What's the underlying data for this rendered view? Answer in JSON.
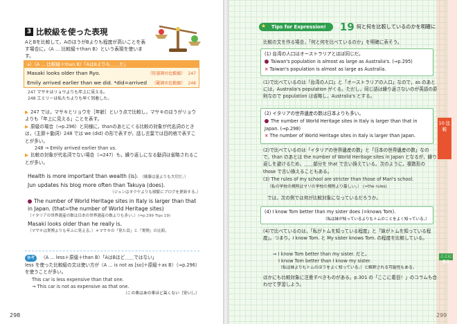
{
  "left": {
    "page_number": "298",
    "section_number": "3",
    "section_title": "比較級を使った表現",
    "intro": "AとBを比較して，AのほうがBよりも程度が高いことを表す場合に，〈A ... 比較級＋than B〉という表現を使います。",
    "example_box_header": "a）〈A ... 比較級＋than B〉「AはBよりも＿＿だ」",
    "examples": [
      {
        "text": "Masaki looks older than Ryo.",
        "sub": "（形容詞の比較級）",
        "num": "247"
      },
      {
        "text": "Emily arrived earlier than we did.  *did=arrived",
        "sub": "（副詞の比較級）",
        "num": "248"
      }
    ],
    "jp_notes": [
      "247 マサキはリョウよりも年上に見える。",
      "248 エミリーは私たちよりも早く到着した。"
    ],
    "bullets": [
      "247 では，マサキとリョウを［年齢］という点で比較し，マサキのほうがリョウよりも「年上に見える」ことを表す。",
      "原級の場合（⇒p.296）と同様に，thanのあとにくる比較の対象が代名詞のときは，〈主節＋動詞〉248 では we (did) の形で表すが，話し言葉では目的格で表すことが多い。",
      "248 → Emily arrived earlier than us.",
      "比較の対象が代名詞でない場合（⇒247）も，繰り返しになる動詞は省略されることが多い。"
    ],
    "more_examples": [
      {
        "en": "Health is more important than wealth (is).",
        "jp": "（健康は富よりも大切だ。）"
      },
      {
        "en": "Jun updates his blog more often than Takuya (does).",
        "jp": "（ジュンはタクヤよりも頻繁にブログを更新する。）"
      },
      {
        "en": "The number of World Heritage sites in Italy is larger than that in Japan.  (that=the number of World Heritage sites)",
        "jp": "（イタリアの世界遺産の数は日本の世界遺産の数よりも多い。）(⇒p.299 Tips 19)"
      },
      {
        "en": "Masaki looks older than he really is.",
        "jp": "（マサキは実際よりも年上に見える。）＊マサキの「見た目」と「実際」の比較。"
      }
    ],
    "sankou_tag": "参考",
    "sankou": [
      "〈A ... less＋原級＋than B〉「AはBほど＿＿ではない」",
      "less を使った比較級の文は使い方が〈A ... is not as [so]＋原級＋as B〉（⇒p.296）を使うことが多い。",
      "This car is less expensive than that one.",
      "→ This car is not as expensive as that one.",
      "（この車はあの車ほど高くない［安い］。）"
    ]
  },
  "right": {
    "page_number": "299",
    "tips_label": "Tips for Expression!",
    "tips_number": "19",
    "tips_title": "何と何を比較しているのかを明確に",
    "intro": "比較の文を作る場合，「何と何を比べているのか」を明確に表そう。",
    "box1": {
      "jp": "(1) 台湾の人口はオーストラリアとほぼ同じだ。",
      "ok": "Taiwan's population is almost as large as Australia's. (⇒p.295)",
      "ng": "Taiwan's population is almost as large as Australia."
    },
    "para1": "(1)で比べているのは「台湾の人口」と「オーストラリアの人口」なので，as のあとには，Australia's population がくる。ただし，同じ語は繰り返さないのが英語の原則なので population は省略し，Australia's とする。",
    "box2": {
      "jp": "(2) イタリアの世界遺産の数は日本よりも多い。",
      "ok": "The number of World Heritage sites in Italy is larger than that in Japan. (⇒p.298)",
      "ng": "The number of World Heritage sites in Italy is larger than Japan."
    },
    "para2": "(2)で比べているのは「イタリアの世界遺産の数」と「日本の世界遺産の数」なので，than のあとは the number of World Heritage sites in Japan となるが，繰り返しを避けるため，＿＿部分を that で言い換えている。次のように，複数形の those で言い換えることもある。",
    "ex3": "(3) The rules of my school are stricter than those of Mari's school.",
    "ex3_jp": "（私の学校の規則はマリの学校の規則より厳しい。）  (=the rules)",
    "question": "では，次の例では何が比較対象になっているだろうか。",
    "box4": "(4) I know Tom better than my sister does (=knows Tom).",
    "box4_jp": "（私は妹が知っているよりもトムのことをよく知っている。）",
    "para4": "(4)で比べているのは，「私がトムを知っている程度」と「妹がトムを知っている程度」。つまり，I know Tom. と My sister knows Tom. の程度を比較している。",
    "ex5": [
      "⇒ I know Tom better than my sister. だと，",
      "I know Tom better than I know my sister.",
      "（私は妹よりもトムのほうをよく知っている。）と解釈される可能性もある。"
    ],
    "closing": "ほかにも比較対象に注意すべきものがある。p.301 の「ここに着目！」のコラムも合わせて学習しよう。",
    "side_tab": "10 比較",
    "side_tab2": "ここに着目"
  },
  "colors": {
    "accent_orange": "#f39a2c",
    "accent_green": "#2f9e4f",
    "accent_red": "#e8542f",
    "highlight_pink": "#ffd6e2"
  }
}
